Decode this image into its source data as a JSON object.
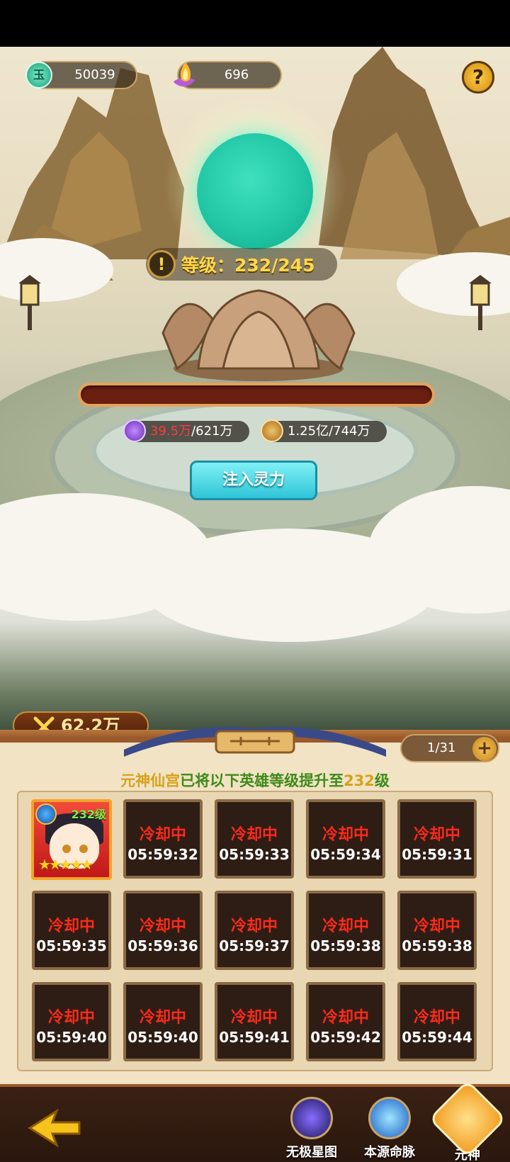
{
  "currencies": {
    "jade": {
      "value": "50039",
      "icon": "jade-coin-icon",
      "icon_glyph": "玉"
    },
    "spirit_fire": {
      "value": "696",
      "icon": "purple-flame-icon"
    }
  },
  "help": {
    "glyph": "?"
  },
  "level": {
    "label": "等级：232/245",
    "warn_glyph": "!"
  },
  "costs": {
    "spirit": {
      "have": "39.5万",
      "need": "/621万",
      "have_color": "#ff3b3b"
    },
    "coin": {
      "text": "1.25亿/744万"
    }
  },
  "progress": {
    "fraction": 0.0
  },
  "inject_button": "注入灵力",
  "power": {
    "value": "62.2万",
    "icon": "crossed-swords-icon"
  },
  "page": {
    "text": "1/31",
    "plus": "+"
  },
  "notice": {
    "prefix": "元神仙宫",
    "mid": "已将以下英雄等级提升至",
    "level": "232",
    "suffix": "级"
  },
  "hero_slot": {
    "level_label": "232级",
    "stars": "★★★★★"
  },
  "slots": [
    {
      "status": "冷却中",
      "time": "05:59:32"
    },
    {
      "status": "冷却中",
      "time": "05:59:33"
    },
    {
      "status": "冷却中",
      "time": "05:59:34"
    },
    {
      "status": "冷却中",
      "time": "05:59:31"
    },
    {
      "status": "冷却中",
      "time": "05:59:35"
    },
    {
      "status": "冷却中",
      "time": "05:59:36"
    },
    {
      "status": "冷却中",
      "time": "05:59:37"
    },
    {
      "status": "冷却中",
      "time": "05:59:38"
    },
    {
      "status": "冷却中",
      "time": "05:59:38"
    },
    {
      "status": "冷却中",
      "time": "05:59:40"
    },
    {
      "status": "冷却中",
      "time": "05:59:40"
    },
    {
      "status": "冷却中",
      "time": "05:59:41"
    },
    {
      "status": "冷却中",
      "time": "05:59:42"
    },
    {
      "status": "冷却中",
      "time": "05:59:44"
    }
  ],
  "bottom_nav": [
    {
      "label": "无极星图",
      "icon": "star-map-icon"
    },
    {
      "label": "本源命脉",
      "icon": "origin-vein-icon"
    },
    {
      "label": "元神",
      "icon": "spirit-figure-icon"
    }
  ]
}
